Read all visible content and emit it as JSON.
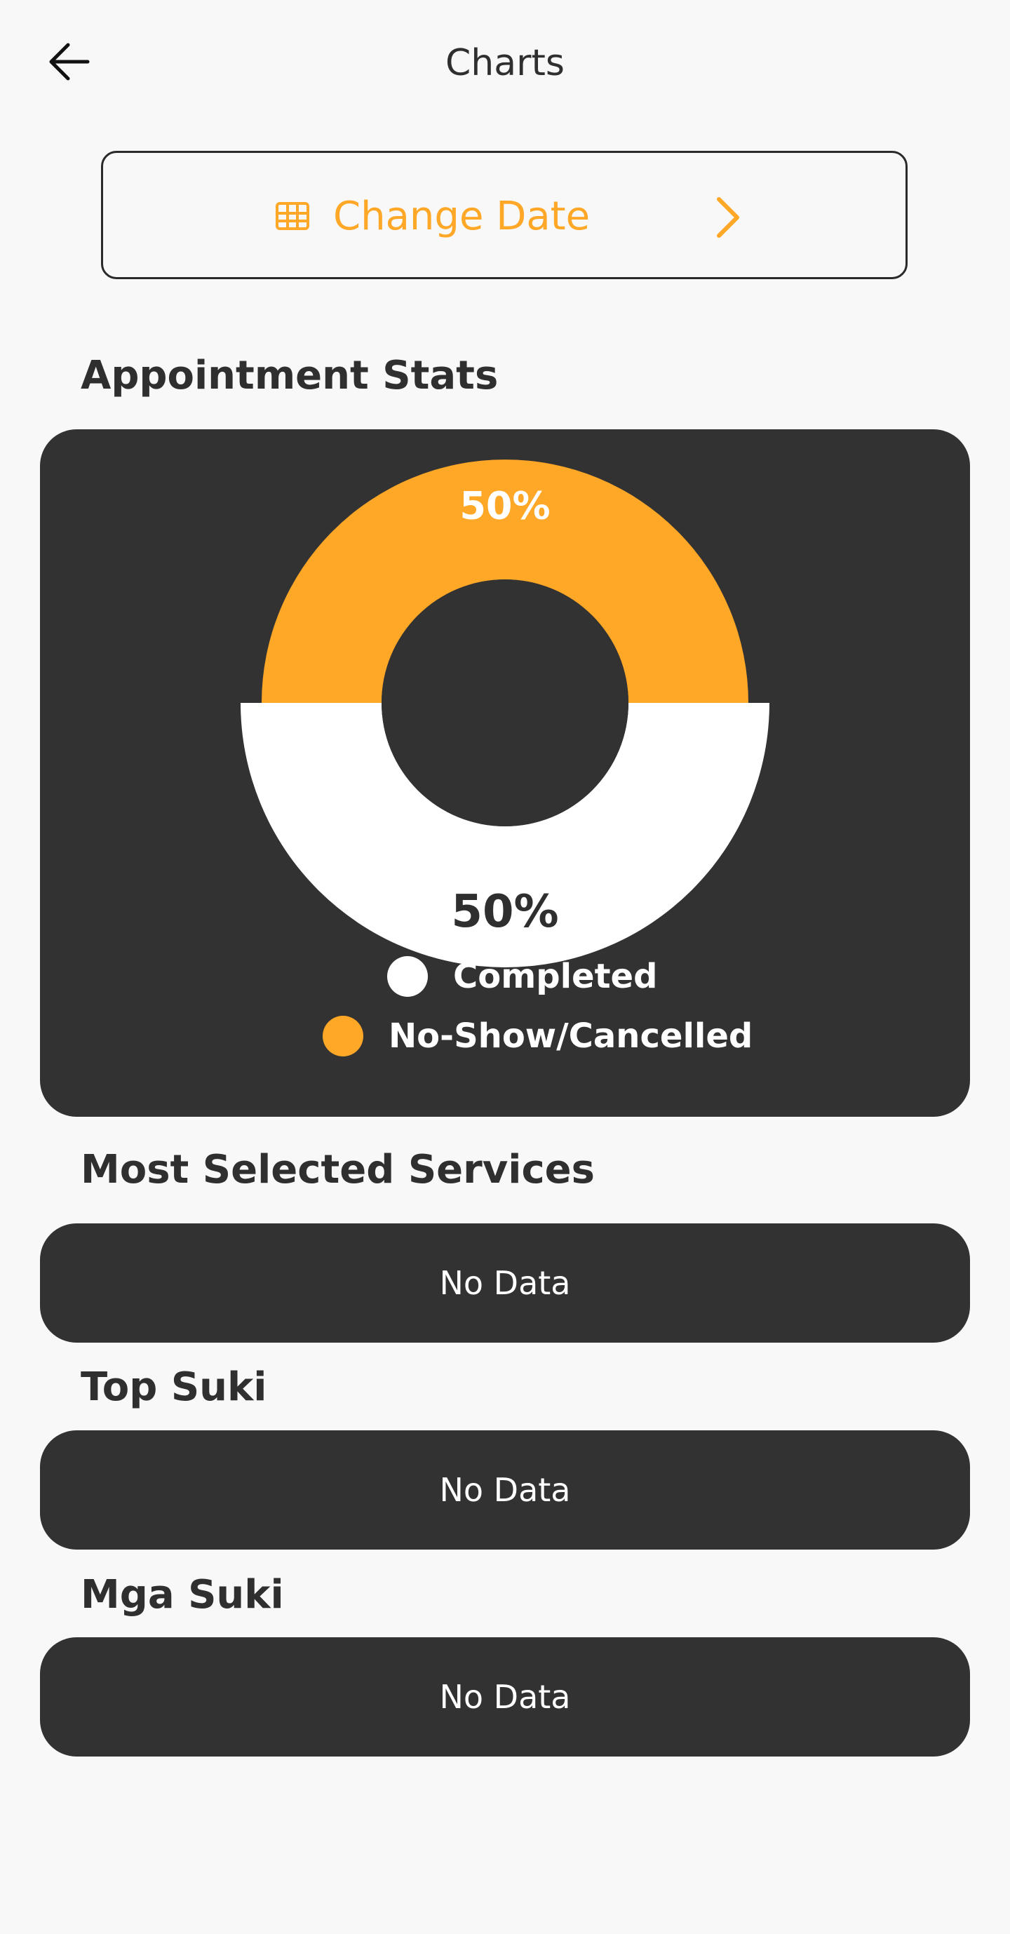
{
  "header": {
    "title": "Charts",
    "back_icon": "arrow-left-icon"
  },
  "change_date": {
    "label": "Change Date",
    "leading_icon": "calendar-grid-icon",
    "trailing_icon": "chevron-right-icon"
  },
  "colors": {
    "accent": "#ffa726",
    "card_background": "#323232",
    "page_background": "#f8f8f8",
    "completed": "#ffffff"
  },
  "appointment_stats": {
    "title": "Appointment Stats",
    "legend": [
      {
        "label": "Completed",
        "color": "#ffffff"
      },
      {
        "label": "No-Show/Cancelled",
        "color": "#ffa726"
      }
    ]
  },
  "chart_data": {
    "type": "pie",
    "variant": "donut",
    "categories": [
      "Completed",
      "No-Show/Cancelled"
    ],
    "values": [
      50,
      50
    ],
    "data_labels": [
      "50%",
      "50%"
    ],
    "colors": [
      "#ffffff",
      "#ffa726"
    ],
    "legend_position": "bottom-center"
  },
  "most_selected_services": {
    "title": "Most Selected Services",
    "empty_text": "No Data"
  },
  "top_suki": {
    "title": "Top Suki",
    "empty_text": "No Data"
  },
  "mga_suki": {
    "title": "Mga Suki",
    "empty_text": "No Data"
  }
}
